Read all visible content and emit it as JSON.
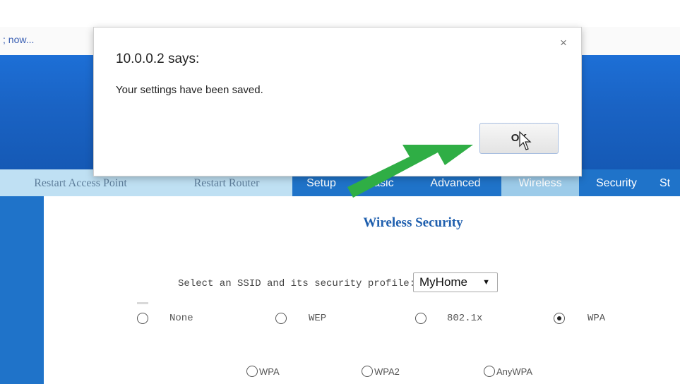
{
  "browser": {
    "status_text": "; now..."
  },
  "nav": {
    "items": [
      {
        "label": "Restart Access Point"
      },
      {
        "label": "Restart Router"
      },
      {
        "label": "Setup"
      },
      {
        "label": "Basic"
      },
      {
        "label": "Advanced"
      },
      {
        "label": "Wireless"
      },
      {
        "label": "Security"
      },
      {
        "label": "St"
      }
    ]
  },
  "content": {
    "section_title": "Wireless Security",
    "ssid_label": "Select an SSID and its security profile:",
    "ssid_selected": "MyHome",
    "security_options_row1": [
      {
        "label": "None",
        "checked": false
      },
      {
        "label": "WEP",
        "checked": false
      },
      {
        "label": "802.1x",
        "checked": false
      },
      {
        "label": "WPA",
        "checked": true
      }
    ],
    "security_options_row2": [
      {
        "label": "WPA",
        "checked": false
      },
      {
        "label": "WPA2",
        "checked": false
      },
      {
        "label": "AnyWPA",
        "checked": false
      }
    ]
  },
  "dialog": {
    "title": "10.0.0.2 says:",
    "message": "Your settings have been saved.",
    "ok_label": "OK",
    "close_symbol": "×"
  },
  "annotation": {
    "arrow_color": "#2fae45",
    "arrow_icon": "pointer-arrow-icon"
  },
  "colors": {
    "header_blue": "#1a63c4",
    "nav_light": "#bfe0f3",
    "nav_dark": "#1f73c9",
    "title_blue": "#1f5fae"
  }
}
